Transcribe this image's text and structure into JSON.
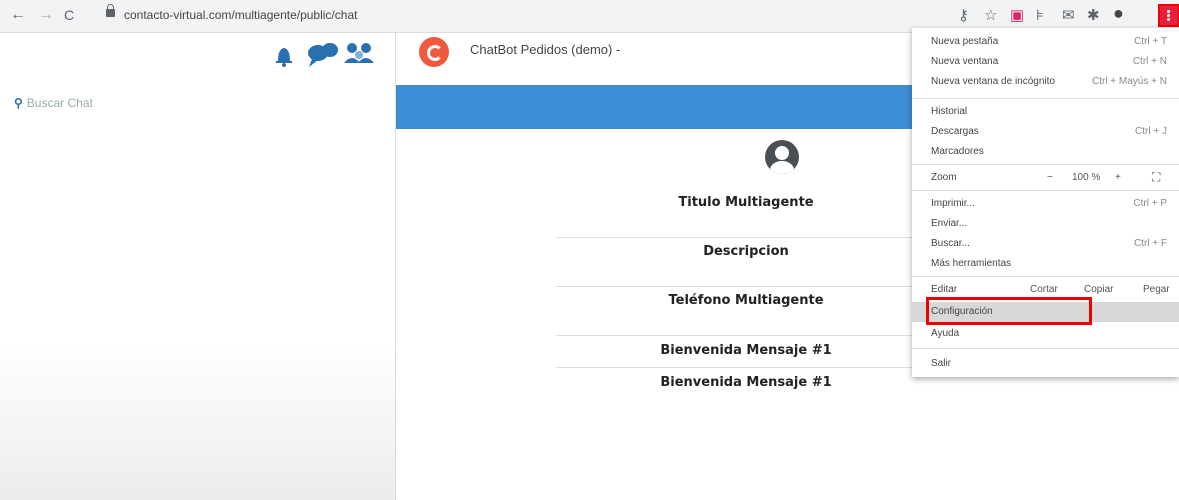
{
  "browser": {
    "url": "contacto-virtual.com/multiagente/public/chat",
    "nav_back": "←",
    "nav_forward": "→",
    "nav_reload": "C"
  },
  "sidebar": {
    "search_placeholder": "Buscar Chat"
  },
  "chat": {
    "title": "ChatBot Pedidos (demo) -"
  },
  "profile": {
    "titulo": "Titulo Multiagente",
    "descripcion": "Descripcion",
    "telefono": "Teléfono Multiagente",
    "bienvenida1": "Bienvenida Mensaje #1",
    "bienvenida2": "Bienvenida Mensaje #1"
  },
  "menu": {
    "nueva_pestana": {
      "label": "Nueva pestaña",
      "shortcut": "Ctrl + T"
    },
    "nueva_ventana": {
      "label": "Nueva ventana",
      "shortcut": "Ctrl + N"
    },
    "incognito": {
      "label": "Nueva ventana de incógnito",
      "shortcut": "Ctrl + Mayús + N"
    },
    "historial": {
      "label": "Historial"
    },
    "descargas": {
      "label": "Descargas",
      "shortcut": "Ctrl + J"
    },
    "marcadores": {
      "label": "Marcadores"
    },
    "zoom": {
      "label": "Zoom",
      "minus": "−",
      "value": "100 %",
      "plus": "+",
      "fullscreen": "⛶"
    },
    "imprimir": {
      "label": "Imprimir...",
      "shortcut": "Ctrl + P"
    },
    "enviar": {
      "label": "Enviar..."
    },
    "buscar": {
      "label": "Buscar...",
      "shortcut": "Ctrl + F"
    },
    "mas_herramientas": {
      "label": "Más herramientas"
    },
    "editar": {
      "label": "Editar",
      "cortar": "Cortar",
      "copiar": "Copiar",
      "pegar": "Pegar"
    },
    "configuracion": {
      "label": "Configuración"
    },
    "ayuda": {
      "label": "Ayuda"
    },
    "salir": {
      "label": "Salir"
    }
  },
  "colors": {
    "banner": "#3b8ed3",
    "highlight": "#e00000",
    "accent_icons": "#2a6fb0"
  }
}
